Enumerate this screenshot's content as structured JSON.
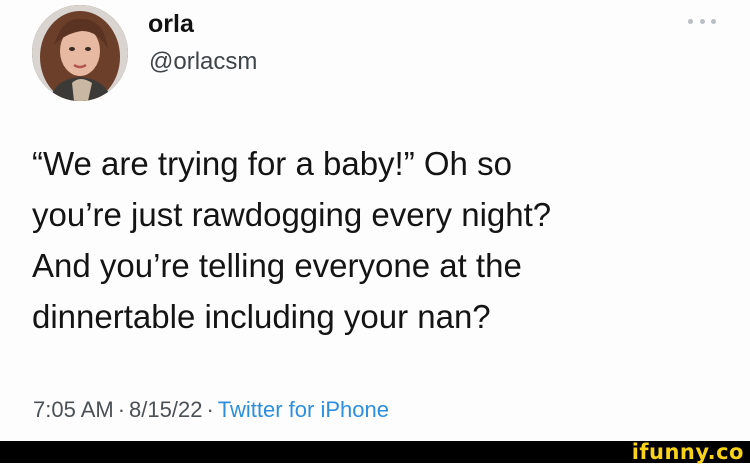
{
  "user": {
    "display_name": "orla",
    "handle": "@orlacsm"
  },
  "tweet": {
    "text": "“We are trying for a baby!” Oh so\nyou’re just rawdogging every night?\nAnd you’re telling everyone at the\ndinnertable including your nan?",
    "time": "7:05 AM",
    "date": "8/15/22",
    "source": "Twitter for iPhone",
    "separator": "·"
  },
  "watermark": {
    "text": "ifunny.co",
    "color": "#f8d31a"
  },
  "colors": {
    "source_link": "#2d8fdd",
    "text": "#141414"
  },
  "icons": {
    "more": "more-options-icon"
  }
}
